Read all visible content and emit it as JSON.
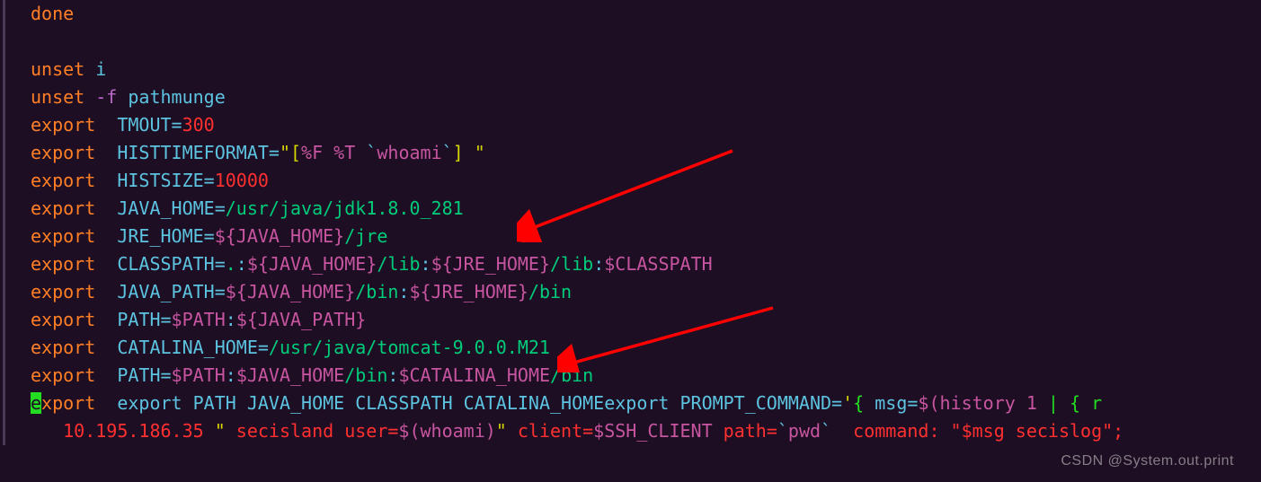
{
  "code": {
    "l1_done": "done",
    "l3_unset": "unset",
    "l3_i": " i",
    "l4_unset": "unset",
    "l4_flag": " -f",
    "l4_pathmunge": " pathmunge",
    "l5_export": "export",
    "l5_tmout": "  TMOUT=",
    "l5_val": "300",
    "l6_export": "export",
    "l6_var": "  HISTTIMEFORMAT=",
    "l6_q1": "\"[",
    "l6_fmt": "%F %T",
    "l6_tick1": " `",
    "l6_who": "whoami",
    "l6_tick2": "`",
    "l6_q2": "] \"",
    "l7_export": "export",
    "l7_var": "  HISTSIZE=",
    "l7_val": "10000",
    "l8_export": "export",
    "l8_var": "  JAVA_HOME=",
    "l8_val": "/usr/java/jdk1.8.0_281",
    "l9_export": "export",
    "l9_var": "  JRE_HOME=",
    "l9_expr": "${JAVA_HOME}",
    "l9_suffix": "/jre",
    "l10_export": "export",
    "l10_var": "  CLASSPATH=",
    "l10_dot": ".",
    "l10_c1": ":",
    "l10_e1": "${JAVA_HOME}",
    "l10_s1": "/lib",
    "l10_c2": ":",
    "l10_e2": "${JRE_HOME}",
    "l10_s2": "/lib",
    "l10_c3": ":",
    "l10_e3": "$CLASSPATH",
    "l11_export": "export",
    "l11_var": "  JAVA_PATH=",
    "l11_e1": "${JAVA_HOME}",
    "l11_s1": "/bin",
    "l11_c1": ":",
    "l11_e2": "${JRE_HOME}",
    "l11_s2": "/bin",
    "l12_export": "export",
    "l12_var": "  PATH=",
    "l12_e1": "$PATH",
    "l12_c1": ":",
    "l12_e2": "${JAVA_PATH}",
    "l13_export": "export",
    "l13_var": "  CATALINA_HOME=",
    "l13_val": "/usr/java/tomcat-9.0.0.M21",
    "l14_export": "export",
    "l14_var": "  PATH=",
    "l14_e1": "$PATH",
    "l14_c1": ":",
    "l14_e2": "$JAVA_HOME",
    "l14_s1": "/bin",
    "l14_c2": ":",
    "l14_e3": "$CATALINA_HOME",
    "l14_s2": "/bin",
    "l15_e": "e",
    "l15_xport": "xport",
    "l15_rest1": "  export PATH JAVA_HOME CLASSPATH CATALINA_HOMEexport PROMPT_COMMAND=",
    "l15_q": "'",
    "l15_brace": "{",
    "l15_msg": " msg=",
    "l15_hist": "$(history 1 ",
    "l15_pipe": "|",
    "l15_brace2": " { r",
    "l16_ip": "   10.195.186.35 ",
    "l16_q1": "\"",
    "l16_seci": " secisland user=",
    "l16_who": "$(whoami)",
    "l16_q2": "\"",
    "l16_client": " client=",
    "l16_ssh": "$SSH_CLIENT",
    "l16_path": " path=",
    "l16_tick1": "`",
    "l16_pwd": "pwd",
    "l16_tick2": "`",
    "l16_cmd": "  command: ",
    "l16_end": "\"$msg secislog\";"
  },
  "watermark": "CSDN @System.out.print"
}
